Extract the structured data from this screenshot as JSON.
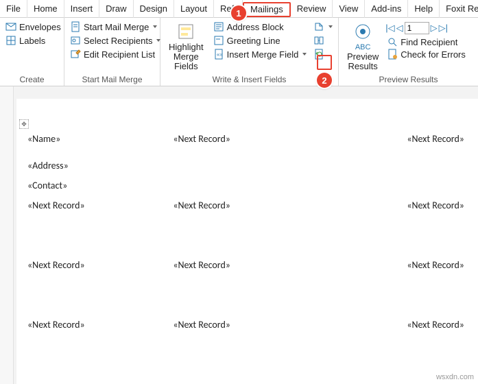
{
  "tabs": {
    "file": "File",
    "home": "Home",
    "insert": "Insert",
    "draw": "Draw",
    "design": "Design",
    "layout": "Layout",
    "references": "Refere",
    "mailings": "Mailings",
    "review": "Review",
    "view": "View",
    "addins": "Add-ins",
    "help": "Help",
    "foxit": "Foxit Reader"
  },
  "ribbon": {
    "create": {
      "envelopes": "Envelopes",
      "labels": "Labels",
      "group": "Create"
    },
    "start": {
      "startmm": "Start Mail Merge",
      "select": "Select Recipients",
      "edit": "Edit Recipient List",
      "group": "Start Mail Merge"
    },
    "write": {
      "highlight_l1": "Highlight",
      "highlight_l2": "Merge Fields",
      "addr": "Address Block",
      "greet": "Greeting Line",
      "insertmf": "Insert Merge Field",
      "group": "Write & Insert Fields"
    },
    "preview": {
      "abc": "ABC",
      "preview_l1": "Preview",
      "preview_l2": "Results",
      "recno": "1",
      "find": "Find Recipient",
      "errors": "Check for Errors",
      "group": "Preview Results"
    }
  },
  "annotations": {
    "badge1": "1",
    "badge2": "2"
  },
  "doc": {
    "name": "«Name»",
    "address": "«Address»",
    "contact": "«Contact»",
    "next": "«Next Record»"
  },
  "watermark": "wsxdn.com"
}
